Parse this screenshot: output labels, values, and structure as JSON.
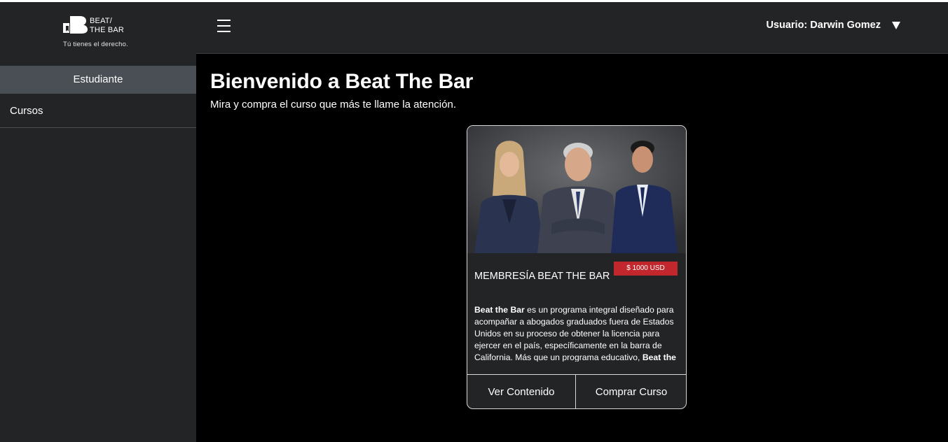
{
  "brand": {
    "logo_line1": "BEAT/",
    "logo_line2": "THE BAR",
    "tagline": "Tú tienes el derecho."
  },
  "sidebar": {
    "header": "Estudiante",
    "items": [
      {
        "label": "Cursos"
      }
    ]
  },
  "topbar": {
    "menu_icon": "hamburger-icon",
    "user_label": "Usuario: Darwin Gomez",
    "user_dropdown_icon": "caret-down-icon"
  },
  "main": {
    "title": "Bienvenido a Beat The Bar",
    "subtitle": "Mira y compra el curso que más te llame la atención."
  },
  "course_card": {
    "title": "MEMBRESÍA BEAT THE BAR",
    "price": "$ 1000 USD",
    "desc_bold_1": "Beat the Bar",
    "desc_text": " es un programa integral diseñado para acompañar a abogados graduados fuera de Estados Unidos en su proceso de obtener la licencia para ejercer en el país, específicamente en la barra de California. Más que un programa educativo, ",
    "desc_bold_2": "Beat the",
    "btn_view": "Ver Contenido",
    "btn_buy": "Comprar Curso"
  },
  "colors": {
    "sidebar_bg": "#232426",
    "sidebar_active": "#4a4e55",
    "price_badge": "#c1272d",
    "page_bg": "#000000"
  }
}
